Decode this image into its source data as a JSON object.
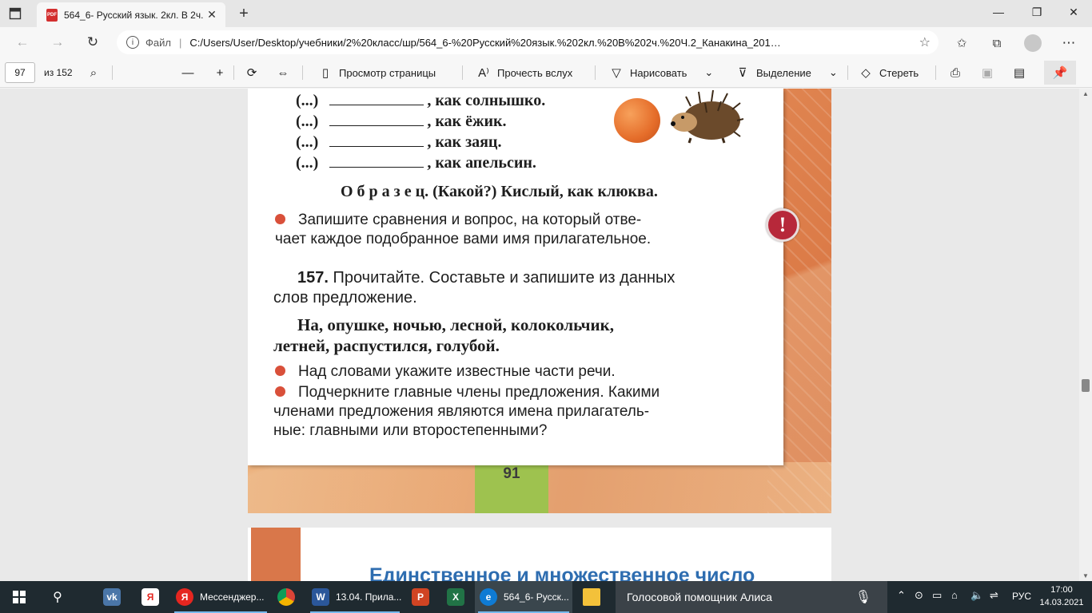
{
  "browser": {
    "tab_title": "564_6- Русский язык. 2кл. В 2ч.",
    "tab_close": "✕",
    "new_tab": "+",
    "address_label": "Файл",
    "address_separator": "|",
    "url": "C:/Users/User/Desktop/учебники/2%20класс/шр/564_6-%20Русский%20язык.%202кл.%20В%202ч.%20Ч.2_Канакина_201…",
    "window_controls": [
      "—",
      "❐",
      "✕"
    ],
    "pdf_badge": "PDF"
  },
  "pdf_toolbar": {
    "page_number": "97",
    "page_total": "из 152",
    "page_view": "Просмотр страницы",
    "read_aloud": "Прочесть вслух",
    "draw": "Нарисовать",
    "highlight": "Выделение",
    "erase": "Стереть"
  },
  "page": {
    "rows": [
      {
        "prefix": "(...)",
        "rest": ", как солнышко."
      },
      {
        "prefix": "(...)",
        "rest": ", как ёжик."
      },
      {
        "prefix": "(...)",
        "rest": ", как заяц."
      },
      {
        "prefix": "(...)",
        "rest": ", как апельсин."
      }
    ],
    "sample_word": "О б р а з е ц.",
    "sample_text": " (Какой?) Кислый, как клюква.",
    "task1_line1": "Запишите сравнения и вопрос, на который отве-",
    "task1_line2": "чает каждое подобранное вами имя прилагательное.",
    "ex_number": "157.",
    "ex_line1": " Прочитайте. Составьте и запишите из данных",
    "ex_line2": "слов предложение.",
    "words_line1": "На,  опушке,  ночью,  лесной,  колокольчик,",
    "words_line2": "летней,  распустился,  голубой.",
    "task2": "Над словами укажите известные части речи.",
    "task3_line1": "Подчеркните главные члены предложения. Какими",
    "task3_line2": "членами предложения являются имена прилагатель-",
    "task3_line3": "ные: главными или второстепенными?",
    "excl_mark": "!",
    "page_no": "91",
    "next_heading": "Единственное  и  множественное  число"
  },
  "taskbar": {
    "items": [
      {
        "label": "Мессенджер...",
        "icon": "Я"
      },
      {
        "label": "13.04. Прила...",
        "icon": "W"
      },
      {
        "label": "564_6- Русск...",
        "icon": "e"
      }
    ],
    "voice_assistant": "Голосовой помощник Алиса",
    "lang": "РУС",
    "time": "17:00",
    "date": "14.03.2021"
  },
  "colors": {
    "accent_blue": "#2e6db0",
    "bullet_red": "#d9503a",
    "page_tab_green": "#9ec24f",
    "alert_red": "#b7283a"
  }
}
